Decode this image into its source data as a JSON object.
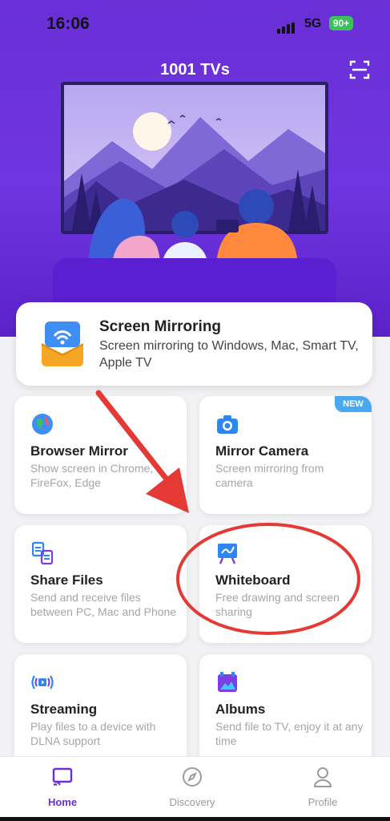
{
  "status_bar": {
    "time": "16:06",
    "network": "5G",
    "battery": "90+"
  },
  "header": {
    "title": "1001 TVs",
    "scan_icon": "scan-frame-icon"
  },
  "feature": {
    "title": "Screen Mirroring",
    "description": "Screen mirroring to Windows, Mac, Smart TV, Apple TV",
    "icon": "screen-mirroring-icon"
  },
  "cards": [
    {
      "title": "Browser Mirror",
      "description": "Show screen in Chrome, FireFox, Edge",
      "icon": "browser-globe-icon",
      "badge": ""
    },
    {
      "title": "Mirror Camera",
      "description": "Screen mirroring from camera",
      "icon": "camera-icon",
      "badge": "NEW"
    },
    {
      "title": "Share Files",
      "description": "Send and receive files between PC, Mac and Phone",
      "icon": "share-files-icon",
      "badge": ""
    },
    {
      "title": "Whiteboard",
      "description": "Free drawing and screen sharing",
      "icon": "whiteboard-icon",
      "badge": ""
    },
    {
      "title": "Streaming",
      "description": "Play files to a device with DLNA support",
      "icon": "streaming-icon",
      "badge": ""
    },
    {
      "title": "Albums",
      "description": "Send file to TV, enjoy it at any time",
      "icon": "albums-icon",
      "badge": ""
    }
  ],
  "tabs": [
    {
      "label": "Home",
      "icon": "cast-icon",
      "active": true
    },
    {
      "label": "Discovery",
      "icon": "compass-icon",
      "active": false
    },
    {
      "label": "Profile",
      "icon": "person-icon",
      "active": false
    }
  ],
  "colors": {
    "brand": "#6a2fd6",
    "annotation": "#e53935",
    "badge": "#4aa8f0"
  }
}
